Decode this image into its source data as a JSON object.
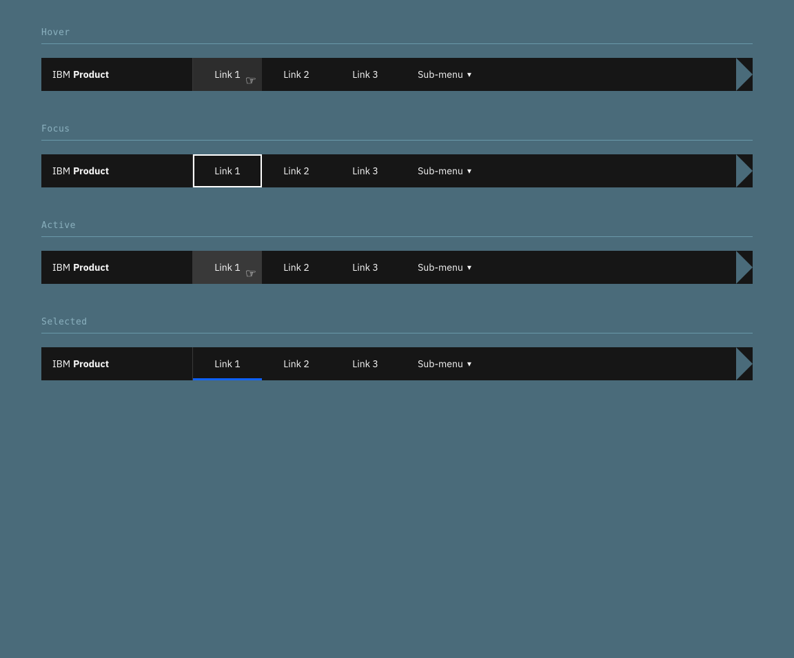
{
  "sections": [
    {
      "id": "hover",
      "label": "Hover",
      "state": "hover"
    },
    {
      "id": "focus",
      "label": "Focus",
      "state": "focus"
    },
    {
      "id": "active",
      "label": "Active",
      "state": "active"
    },
    {
      "id": "selected",
      "label": "Selected",
      "state": "selected"
    }
  ],
  "navbar": {
    "brand_ibm": "IBM",
    "brand_product": "Product",
    "links": [
      "Link 1",
      "Link 2",
      "Link 3"
    ],
    "submenu_label": "Sub-menu",
    "chevron": "▾"
  }
}
